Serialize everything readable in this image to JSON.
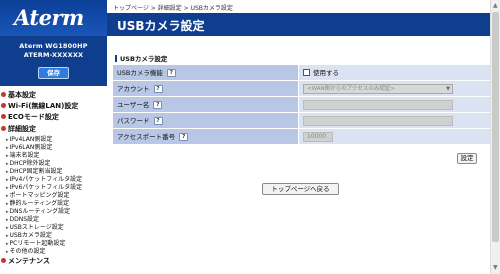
{
  "sidebar": {
    "logo": "Aterm",
    "model": "Aterm WG1800HP",
    "device_id": "ATERM-XXXXXX",
    "save_label": "保存",
    "nav": [
      {
        "label": "基本設定",
        "type": "top"
      },
      {
        "label": "Wi-Fi(無線LAN)設定",
        "type": "top"
      },
      {
        "label": "ECOモード設定",
        "type": "top"
      },
      {
        "label": "詳細設定",
        "type": "top"
      },
      {
        "label": "IPv4LAN側設定",
        "type": "sub"
      },
      {
        "label": "IPv6LAN側設定",
        "type": "sub"
      },
      {
        "label": "端末名設定",
        "type": "sub"
      },
      {
        "label": "DHCP除外設定",
        "type": "sub"
      },
      {
        "label": "DHCP固定割当設定",
        "type": "sub"
      },
      {
        "label": "IPv4パケットフィルタ設定",
        "type": "sub"
      },
      {
        "label": "IPv6パケットフィルタ設定",
        "type": "sub"
      },
      {
        "label": "ポートマッピング設定",
        "type": "sub"
      },
      {
        "label": "静的ルーティング設定",
        "type": "sub"
      },
      {
        "label": "DNSルーティング設定",
        "type": "sub"
      },
      {
        "label": "DDNS設定",
        "type": "sub"
      },
      {
        "label": "USBストレージ設定",
        "type": "sub"
      },
      {
        "label": "USBカメラ設定",
        "type": "sub"
      },
      {
        "label": "PCリモート起動設定",
        "type": "sub"
      },
      {
        "label": "その他の設定",
        "type": "sub"
      },
      {
        "label": "メンテナンス",
        "type": "top"
      }
    ]
  },
  "main": {
    "breadcrumb": "トップページ > 詳細設定 > USBカメラ設定",
    "title": "USBカメラ設定",
    "section_label": "USBカメラ設定",
    "help_label": "?",
    "rows": [
      {
        "label": "USBカメラ機能",
        "value": "使用する"
      },
      {
        "label": "アカウント",
        "value": "<WAN側からのアクセスのみ認証>"
      },
      {
        "label": "ユーザー名",
        "value": ""
      },
      {
        "label": "パスワード",
        "value": ""
      },
      {
        "label": "アクセスポート番号",
        "value": "10000"
      }
    ],
    "set_label": "設定",
    "top_page_label": "トップページへ戻る"
  },
  "colors": {
    "header_blue": "#0f3e8f",
    "label_cell": "#b8c7e6",
    "value_cell": "#dbe3f3",
    "accent_red": "#c0392b"
  }
}
